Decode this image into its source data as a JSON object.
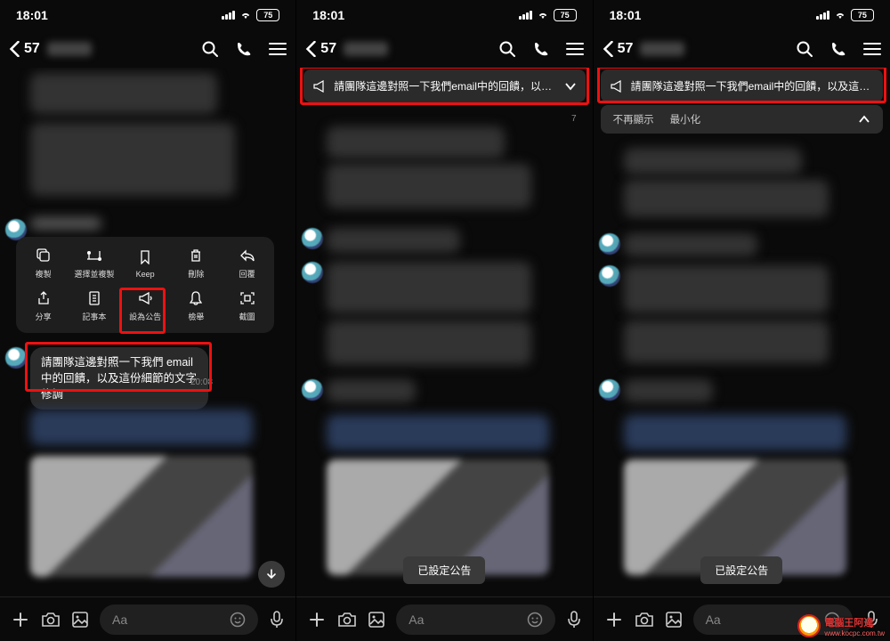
{
  "status": {
    "time": "18:01",
    "battery": "75"
  },
  "nav": {
    "back_count": "57"
  },
  "message": {
    "text": "請團隊這邊對照一下我們 email 中的回饋，以及這份細節的文字修調",
    "time": "20:08"
  },
  "announce": {
    "text_mid": "請團隊這邊對照一下我們email中的回饋，以及...",
    "text_right": "請團隊這邊對照一下我們email中的回饋，以及這份...",
    "opt_hide": "不再顯示",
    "opt_min": "最小化"
  },
  "actions": {
    "copy": "複製",
    "select_copy": "選擇並複製",
    "keep": "Keep",
    "delete": "刪除",
    "reply": "回覆",
    "share": "分享",
    "note": "記事本",
    "set_announce": "設為公告",
    "report": "檢舉",
    "capture": "截圖"
  },
  "toast": {
    "set": "已設定公告"
  },
  "input": {
    "placeholder": "Aa"
  },
  "day_label": "7",
  "watermark": {
    "brand": "電腦王阿達",
    "url": "www.kocpc.com.tw"
  }
}
